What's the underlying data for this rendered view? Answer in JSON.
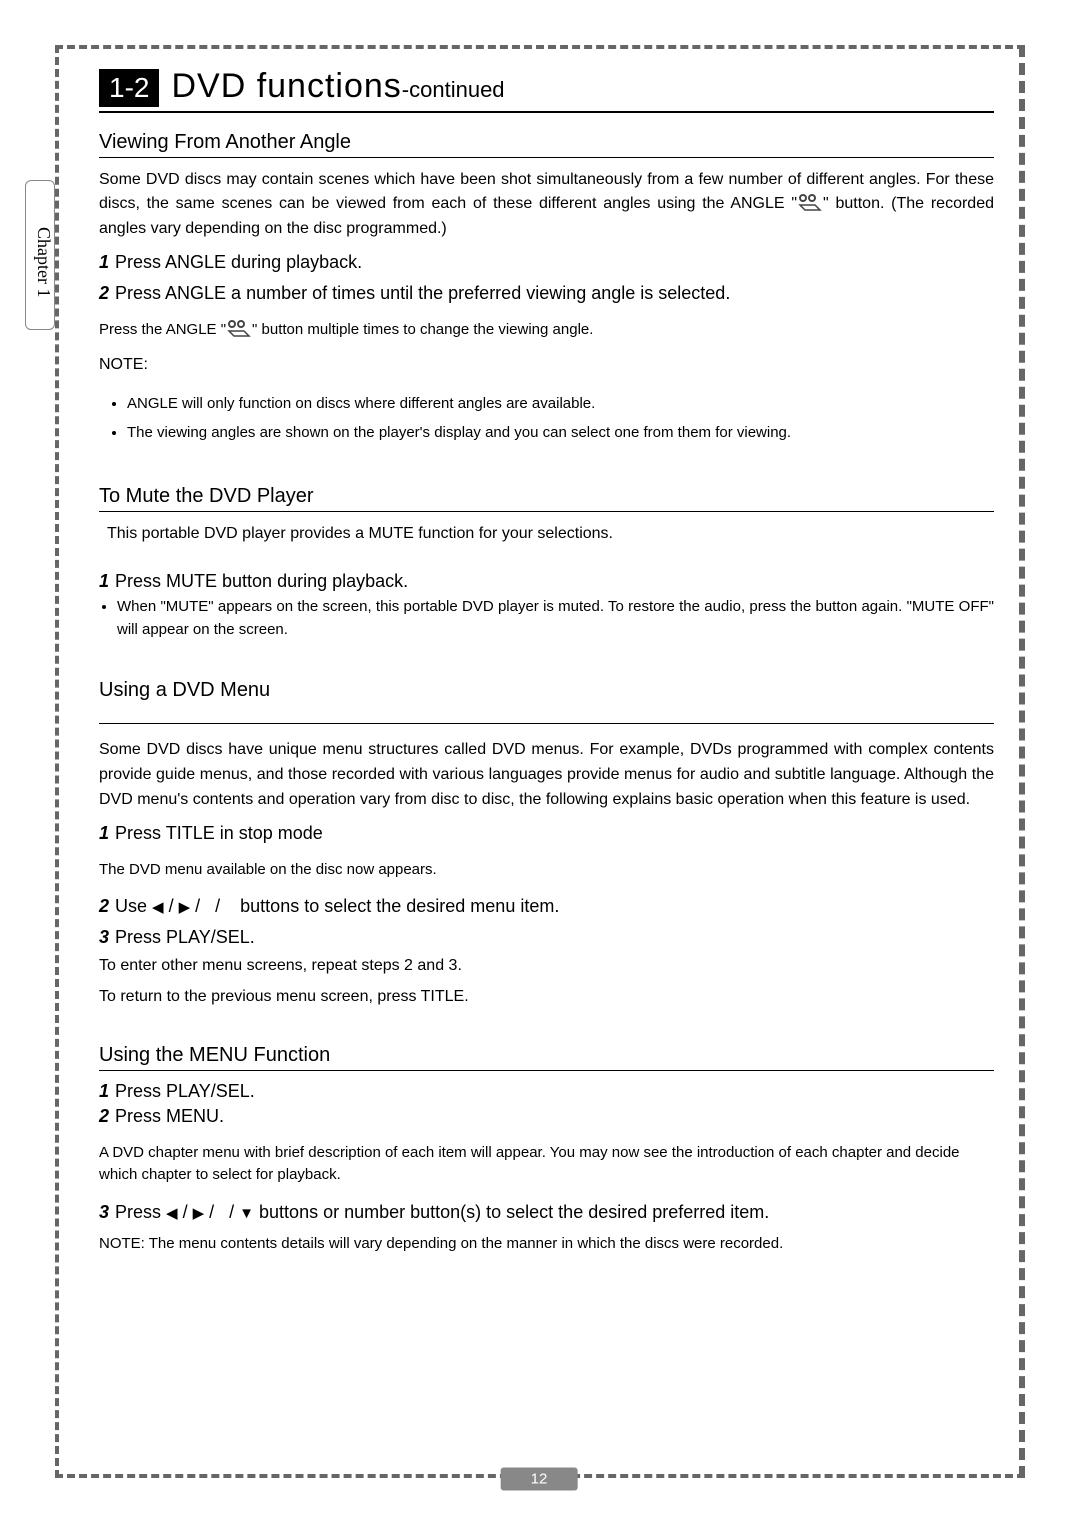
{
  "chapter_tab": "Chapter 1",
  "header": {
    "badge": "1-2",
    "title": "DVD functions",
    "suffix": "-continued"
  },
  "s1": {
    "h": "Viewing From Another Angle",
    "intro_a": "Some DVD discs may contain scenes which have been shot simultaneously from a few number of different angles. For these discs, the same scenes can be viewed from each of these different angles using the ANGLE \"",
    "intro_b": "\" button. (The recorded angles vary depending on the disc programmed.)",
    "step1": "Press ANGLE during playback.",
    "step2": "Press ANGLE a number of times until the preferred viewing angle is selected.",
    "sub2_a": "Press the ANGLE \"",
    "sub2_b": "\" button multiple times to change the viewing angle.",
    "note_label": "NOTE:",
    "notes": [
      "ANGLE will only function on discs where different angles are available.",
      "The viewing angles are shown on the player's display and you can select one from them for viewing."
    ]
  },
  "s2": {
    "h": "To Mute the DVD Player",
    "intro": "This portable DVD player provides a MUTE function for your selections.",
    "step1": "Press MUTE button during playback.",
    "bullets": [
      "When \"MUTE\" appears on the screen, this portable DVD player is muted. To restore the audio, press the button again. \"MUTE OFF\" will appear on the screen."
    ]
  },
  "s3": {
    "h": "Using a DVD Menu",
    "intro": "Some DVD discs have unique menu structures called DVD menus. For example, DVDs programmed with complex contents provide guide menus, and those recorded with various languages provide menus for audio and subtitle language. Although the DVD menu's contents and operation vary from disc to disc, the following explains basic operation when this feature is used.",
    "step1": "Press TITLE in stop mode",
    "sub1": "The DVD menu available on the disc now appears.",
    "step2_a": "Use ",
    "step2_b": " buttons to select the desired menu item.",
    "step3": "Press PLAY/SEL.",
    "after1": "To enter other menu screens, repeat steps 2 and 3.",
    "after2": "To return to the previous menu screen, press TITLE."
  },
  "s4": {
    "h": "Using the MENU Function",
    "step1": "Press PLAY/SEL.",
    "step2": "Press MENU.",
    "sub2": "A DVD chapter menu with brief description of each item will  appear. You may now see the introduction of each chapter and decide which chapter to select for playback.",
    "step3_a": "Press ",
    "step3_b": " buttons or number button(s) to select the desired preferred item.",
    "note": "NOTE:  The menu contents details will vary depending on the manner in which the discs were recorded."
  },
  "page_number": "12",
  "num": {
    "n1": "1",
    "n2": "2",
    "n3": "3"
  }
}
